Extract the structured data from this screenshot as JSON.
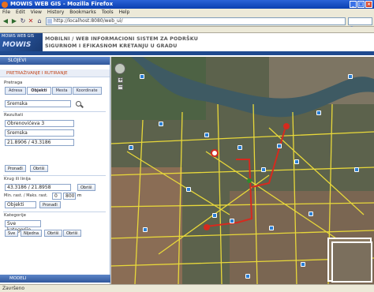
{
  "browser": {
    "title": "MOWIS WEB GIS - Mozilla Firefox",
    "menu": [
      "File",
      "Edit",
      "View",
      "History",
      "Bookmarks",
      "Tools",
      "Help"
    ],
    "url": "http://localhost:8080/web_ui/"
  },
  "header": {
    "logo_top": "MOWIS WEB GIS",
    "logo_word": "MOWIS",
    "title_line1": "MOBILNI / WEB INFORMACIONI SISTEM ZA PODRŠKU",
    "title_line2": "SIGURNOM I EFIKASNOM KRETANJU U GRADU"
  },
  "sidebar": {
    "panel_title": "SLOJEVI",
    "subpanel_title": "PRETRAŽIVANJE I RUTIRANJE",
    "search": {
      "label": "Pretraga",
      "tabs": [
        "Adresa",
        "Objekti",
        "Mesta",
        "Koordinate"
      ],
      "active_tab": "Objekti",
      "value": "Sremska"
    },
    "results": {
      "label": "Rezultati",
      "rows": [
        "Obrenovićeva 3",
        "Sremska",
        "21.8906 / 43.3186"
      ]
    },
    "analysis_buttons": [
      "Pronađi",
      "Obriši"
    ],
    "radius": {
      "label": "Krug ili linija",
      "value": "43.3186 / 21.8958",
      "button": "Obriši",
      "min_label": "Min. rast. / Maks. rast.",
      "min_value": "0",
      "max_value": "800",
      "unit": "m",
      "type_value": "Objekti",
      "find_button": "Pronađi"
    },
    "filter": {
      "label": "Kategorije",
      "value": "Sve kategorije",
      "buttons": [
        "Sve",
        "Nijedna",
        "Obriši",
        "Obriši"
      ]
    },
    "bottom_panel": "MODELI"
  },
  "status": {
    "text": "Završeno"
  }
}
